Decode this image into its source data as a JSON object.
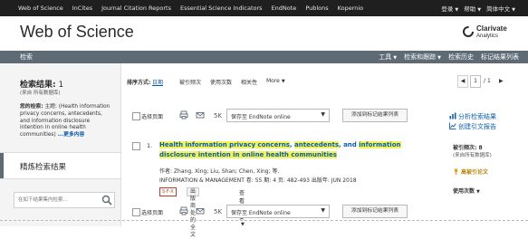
{
  "topnav": {
    "links": [
      "Web of Science",
      "InCites",
      "Journal Citation Reports",
      "Essential Science Indicators",
      "EndNote",
      "Publons",
      "Kopernio"
    ],
    "login": "登录",
    "help": "帮助",
    "language": "简体中文"
  },
  "brand": {
    "title": "Web of Science",
    "logo_name": "Clarivate",
    "logo_sub": "Analytics"
  },
  "navbar": {
    "label": "检索",
    "menu": [
      "工具",
      "检索和跟踪",
      "检索历史",
      "标记结果列表"
    ]
  },
  "sidebar": {
    "results_label": "检索结果:",
    "results_count": "1",
    "from_db": "(来自 所有数据库)",
    "query_label": "您的检索:",
    "query_text": "主题: (Health information privacy concerns, antecedents, and information disclosure intention in online health communities)",
    "more_link": "...更多内容",
    "refine_label": "精炼检索结果",
    "refine_placeholder": "在如下结果集内检索..."
  },
  "sort": {
    "label": "排序方式:",
    "options": [
      "日期",
      "被引频次",
      "使用次数",
      "相关性",
      "More"
    ],
    "active_index": 0
  },
  "pager": {
    "current": "1",
    "total": "1"
  },
  "toolbar": {
    "select_page": "选择页面",
    "count_label": "5K",
    "save_option": "保存至 EndNote online",
    "add_to_list": "添加到标记结果列表"
  },
  "analyze": {
    "analyze_label": "分析检索结果",
    "citation_report": "创建引文报告"
  },
  "record": {
    "index": "1.",
    "title_parts": [
      {
        "text": "Health information privacy concerns",
        "hl": true
      },
      {
        "text": ", ",
        "hl": false
      },
      {
        "text": "antecedents",
        "hl": true
      },
      {
        "text": ", and ",
        "hl": false
      },
      {
        "text": "information disclosure intention in online health communities",
        "hl": true
      }
    ],
    "authors": "作者: Zhang, Xing; Liu, Shan; Chen, Xing; 等.",
    "source": "INFORMATION & MANAGEMENT  卷: 55  期: 4  页: 482-493  出版年: JUN 2018",
    "sfx": "S·F·X",
    "fulltext": "出版商处的全文",
    "abstract": "查看摘要"
  },
  "citedby": {
    "label": "被引频次: 8",
    "source": "(来自所有数据库)",
    "highly_cited": "高被引论文",
    "usage": "使用次数"
  },
  "colors": {
    "topbar": "#1f1f1f",
    "navbar": "#5e6b75",
    "link": "#0a5dab",
    "highlight": "#f1f35b"
  }
}
